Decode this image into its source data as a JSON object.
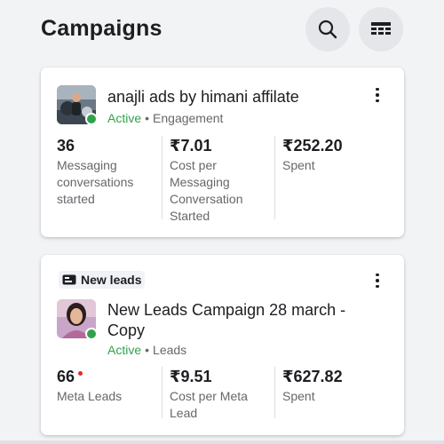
{
  "header": {
    "title": "Campaigns",
    "search_icon": "search-icon",
    "table_icon": "table-view-icon"
  },
  "campaigns": [
    {
      "name": "anajli ads by himani affilate",
      "status": "Active",
      "separator": "•",
      "objective": "Engagement",
      "metrics": [
        {
          "value": "36",
          "label": "Messaging conversations started"
        },
        {
          "value": "₹7.01",
          "label": "Cost per Messaging Conversation Started"
        },
        {
          "value": "₹252.20",
          "label": "Spent"
        }
      ]
    },
    {
      "badge": "New leads",
      "name": "New Leads Campaign 28 march - Copy",
      "status": "Active",
      "separator": "•",
      "objective": "Leads",
      "metrics": [
        {
          "value": "66",
          "label": "Meta Leads"
        },
        {
          "value": "₹9.51",
          "label": "Cost per Meta Lead"
        },
        {
          "value": "₹627.82",
          "label": "Spent"
        }
      ]
    }
  ],
  "colors": {
    "active_green": "#31a24c",
    "alert_red": "#e02d2d",
    "muted_text": "#65676b"
  }
}
